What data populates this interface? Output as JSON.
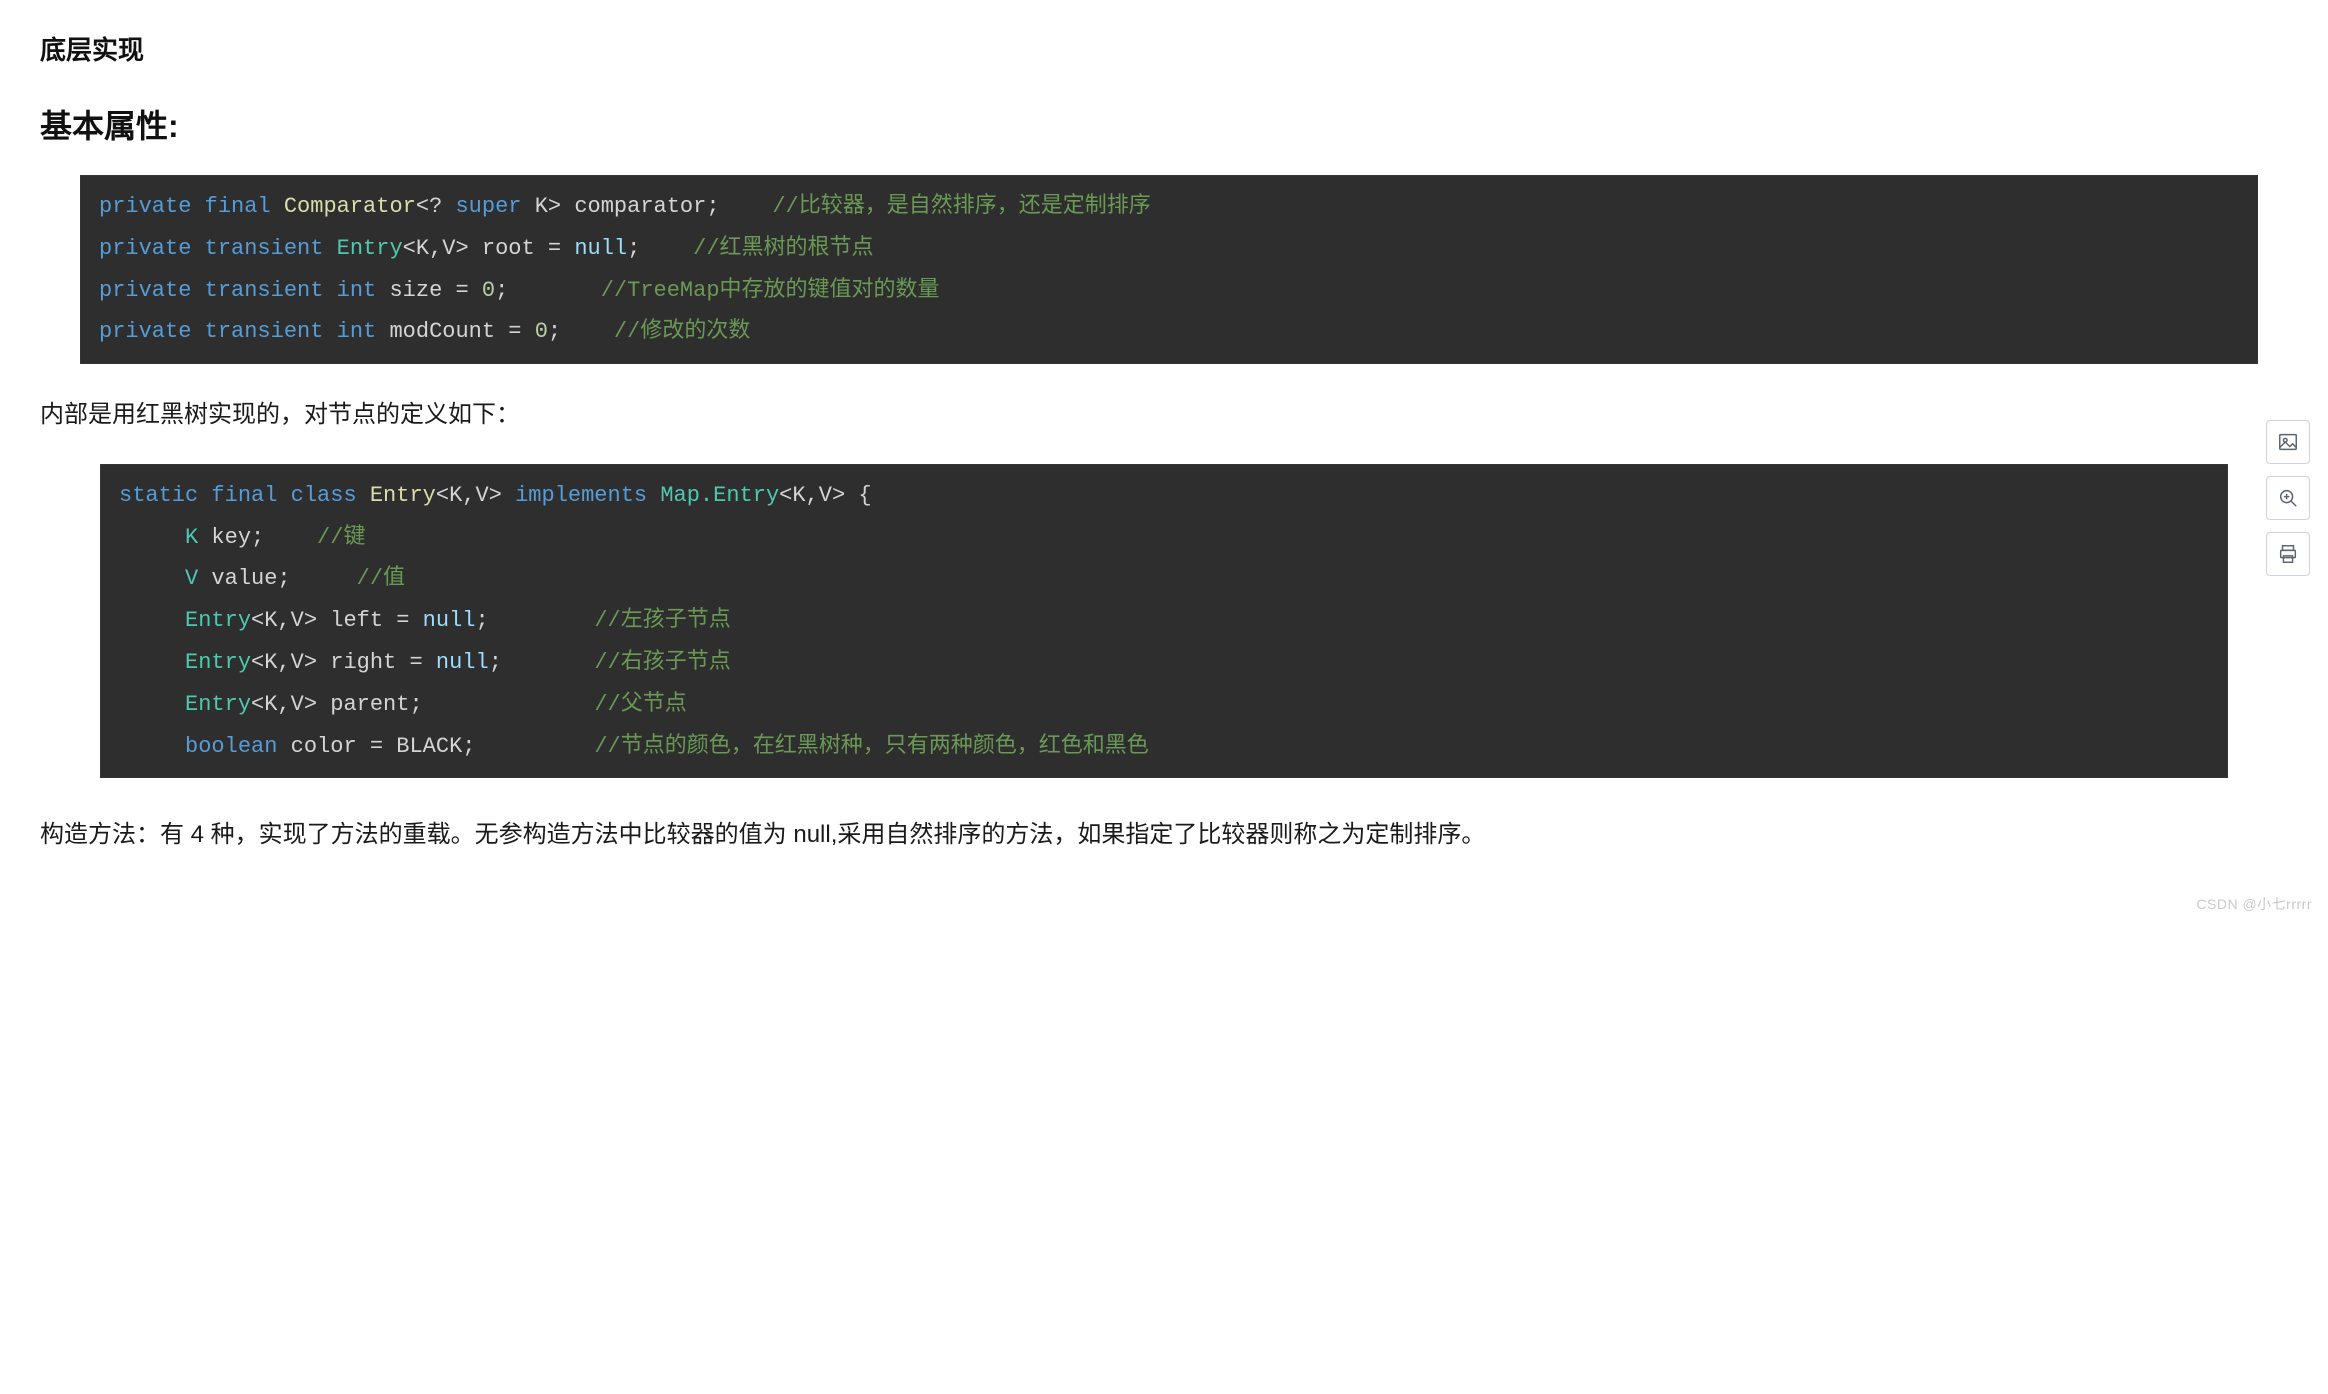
{
  "headings": {
    "section": "底层实现",
    "subsection": "基本属性:"
  },
  "code1": {
    "l1": {
      "a": "private",
      "b": "final",
      "c": "Comparator",
      "d": "<?",
      "e": "super",
      "f": "K>",
      "g": "comparator;",
      "cmt": "//比较器，是自然排序，还是定制排序"
    },
    "l2": {
      "a": "private",
      "b": "transient",
      "c": "Entry",
      "d": "<K,V>",
      "e": "root =",
      "f": "null",
      "g": ";",
      "cmt": "//红黑树的根节点"
    },
    "l3": {
      "a": "private",
      "b": "transient",
      "c": "int",
      "d": "size =",
      "e": "0",
      "f": ";",
      "cmt": "//TreeMap中存放的键值对的数量"
    },
    "l4": {
      "a": "private",
      "b": "transient",
      "c": "int",
      "d": "modCount =",
      "e": "0",
      "f": ";",
      "cmt": "//修改的次数"
    }
  },
  "para1": "内部是用红黑树实现的，对节点的定义如下：",
  "code2": {
    "l1": {
      "a": "static",
      "b": "final",
      "c": "class",
      "d": "Entry",
      "e": "<K,V>",
      "f": "implements",
      "g": "Map.Entry",
      "h": "<K,V>",
      "i": "{"
    },
    "l2": {
      "a": "K",
      "b": "key;",
      "cmt": "//键"
    },
    "l3": {
      "a": "V",
      "b": "value;",
      "cmt": "//值"
    },
    "l4": {
      "a": "Entry",
      "b": "<K,V>",
      "c": "left =",
      "d": "null",
      "e": ";",
      "cmt": "//左孩子节点"
    },
    "l5": {
      "a": "Entry",
      "b": "<K,V>",
      "c": "right =",
      "d": "null",
      "e": ";",
      "cmt": "//右孩子节点"
    },
    "l6": {
      "a": "Entry",
      "b": "<K,V>",
      "c": "parent;",
      "cmt": "//父节点"
    },
    "l7": {
      "a": "boolean",
      "b": "color = BLACK;",
      "cmt": "//节点的颜色，在红黑树种，只有两种颜色，红色和黑色"
    }
  },
  "para2": "构造方法：有 4 种，实现了方法的重载。无参构造方法中比较器的值为 null,采用自然排序的方法，如果指定了比较器则称之为定制排序。",
  "watermark": "CSDN @小七rrrrr",
  "toolbar": {
    "image": "image-icon",
    "zoom": "zoom-in-icon",
    "print": "print-icon"
  }
}
